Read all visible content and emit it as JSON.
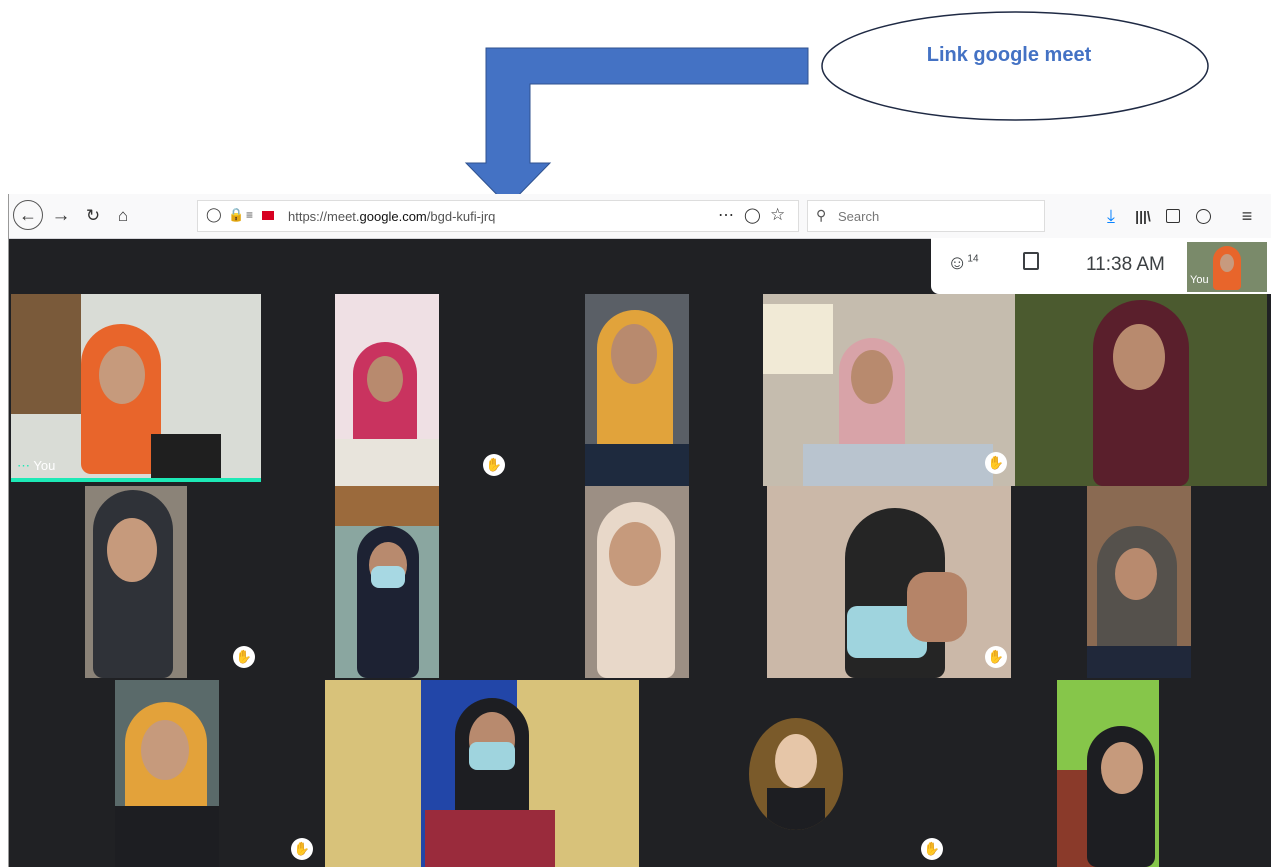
{
  "annotation": {
    "label": "Link google meet",
    "color": "#4472c4"
  },
  "browser": {
    "url_prefix": "https://meet.",
    "url_domain": "google.com",
    "url_path": "/bgd-kufi-jrq",
    "search_placeholder": "Search",
    "icons": [
      "back-icon",
      "forward-icon",
      "reload-icon",
      "home-icon",
      "shield-icon",
      "lock-icon",
      "permissions-icon",
      "camera-icon",
      "page-actions-icon",
      "pocket-icon",
      "bookmark-star-icon",
      "search-icon",
      "download-icon",
      "library-icon",
      "sidebar-icon",
      "account-icon",
      "menu-icon"
    ]
  },
  "meet": {
    "participant_count": "14",
    "time": "11:38 AM",
    "self_label": "You",
    "self_thumb_label": "You",
    "hand_icon": "raised-hand-icon",
    "accent": "#1de9b6"
  }
}
